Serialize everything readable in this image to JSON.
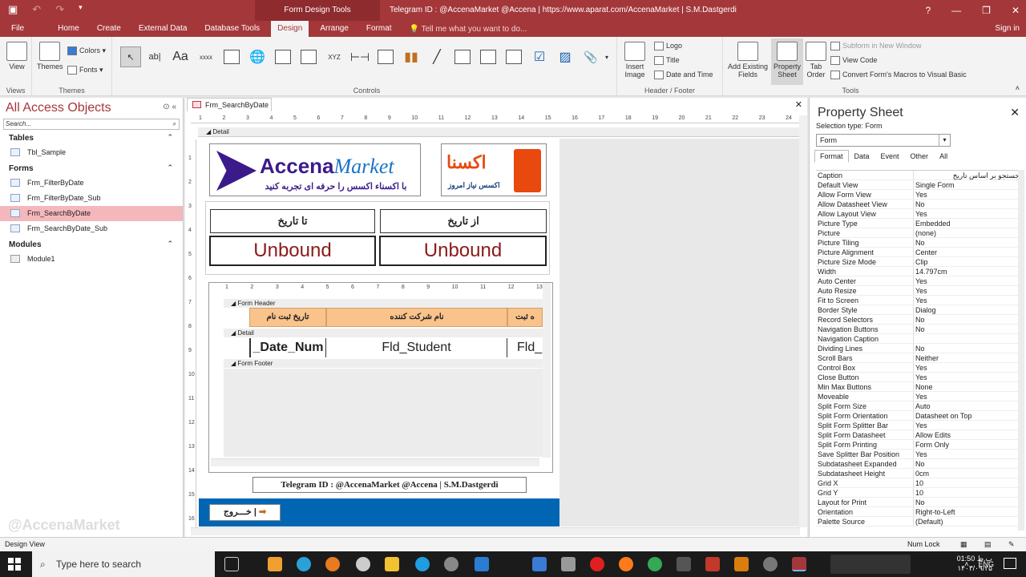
{
  "titlebar": {
    "context_tab": "Form Design Tools",
    "title": "Telegram ID : @AccenaMarket  @Accena  |  https://www.aparat.com/AccenaMarket  |  S.M.Dastgerdi",
    "help": "?"
  },
  "tabs": [
    {
      "label": "File"
    },
    {
      "label": "Home"
    },
    {
      "label": "Create"
    },
    {
      "label": "External Data"
    },
    {
      "label": "Database Tools"
    },
    {
      "label": "Design",
      "active": true
    },
    {
      "label": "Arrange"
    },
    {
      "label": "Format"
    }
  ],
  "tell_me": "Tell me what you want to do...",
  "sign_in": "Sign in",
  "ribbon": {
    "views": {
      "label": "Views",
      "view": "View"
    },
    "themes": {
      "label": "Themes",
      "themes": "Themes",
      "colors": "Colors",
      "fonts": "Fonts"
    },
    "controls": {
      "label": "Controls",
      "textbox": "ab|",
      "labelctl": "Aa",
      "button": "xxxx",
      "toggle": "XYZ"
    },
    "header_footer": {
      "label": "Header / Footer",
      "insert_image": "Insert Image",
      "logo": "Logo",
      "title": "Title",
      "date_time": "Date and Time"
    },
    "tools": {
      "label": "Tools",
      "add_fields": "Add Existing Fields",
      "property_sheet": "Property Sheet",
      "tab_order": "Tab Order",
      "subform": "Subform in New Window",
      "view_code": "View Code",
      "convert": "Convert Form's Macros to Visual Basic"
    }
  },
  "nav": {
    "title": "All Access Objects",
    "search_placeholder": "Search...",
    "sections": [
      {
        "name": "Tables",
        "items": [
          "Tbl_Sample"
        ]
      },
      {
        "name": "Forms",
        "items": [
          "Frm_FilterByDate",
          "Frm_FilterByDate_Sub",
          "Frm_SearchByDate",
          "Frm_SearchByDate_Sub"
        ],
        "selected": "Frm_SearchByDate"
      },
      {
        "name": "Modules",
        "items": [
          "Module1"
        ]
      }
    ]
  },
  "doc": {
    "tab": "Frm_SearchByDate",
    "detail": "Detail",
    "ruler_top": [
      "1",
      "2",
      "3",
      "4",
      "5",
      "6",
      "7",
      "8",
      "9",
      "10",
      "11",
      "12",
      "13",
      "14",
      "15",
      "16",
      "17",
      "18",
      "19",
      "20",
      "21",
      "22",
      "23",
      "24"
    ],
    "ruler_left": [
      "1",
      "2",
      "3",
      "4",
      "5",
      "6",
      "7",
      "8",
      "9",
      "10",
      "11",
      "12",
      "13",
      "14",
      "15",
      "16"
    ],
    "logo1": {
      "brand_a": "Accena",
      "brand_b": "Market",
      "slogan": "با اکسناء اکسس را حرفه ای تجربه کنید"
    },
    "logo2": {
      "brand": "اکسنا",
      "slogan": "اکسس نیاز امروز"
    },
    "to_date": "تا تاریخ",
    "from_date": "از تاریخ",
    "unbound_to": "Unbound",
    "unbound_from": "Unbound",
    "sub": {
      "ruler": [
        "1",
        "2",
        "3",
        "4",
        "5",
        "6",
        "7",
        "8",
        "9",
        "10",
        "11",
        "12",
        "13"
      ],
      "form_header": "Form Header",
      "detail": "Detail",
      "form_footer": "Form Footer",
      "headers": [
        "تاریخ ثبت نام",
        "نام شرکت کننده",
        "ه ثبت"
      ],
      "fields": [
        "_Date_Num",
        "Fld_Student",
        "Fld_"
      ]
    },
    "footer_label": "Telegram ID : @AccenaMarket   @Accena  |  S.M.Dastgerdi",
    "exit_button": "خـــروج  |",
    "watermark": "@AccenaMarket"
  },
  "props": {
    "title": "Property Sheet",
    "selection_type": "Selection type:  Form",
    "selected": "Form",
    "tabs": [
      "Format",
      "Data",
      "Event",
      "Other",
      "All"
    ],
    "rows": [
      [
        "Caption",
        "جستجو بر اساس تاریخ"
      ],
      [
        "Default View",
        "Single Form"
      ],
      [
        "Allow Form View",
        "Yes"
      ],
      [
        "Allow Datasheet View",
        "No"
      ],
      [
        "Allow Layout View",
        "Yes"
      ],
      [
        "Picture Type",
        "Embedded"
      ],
      [
        "Picture",
        "(none)"
      ],
      [
        "Picture Tiling",
        "No"
      ],
      [
        "Picture Alignment",
        "Center"
      ],
      [
        "Picture Size Mode",
        "Clip"
      ],
      [
        "Width",
        "14.797cm"
      ],
      [
        "Auto Center",
        "Yes"
      ],
      [
        "Auto Resize",
        "Yes"
      ],
      [
        "Fit to Screen",
        "Yes"
      ],
      [
        "Border Style",
        "Dialog"
      ],
      [
        "Record Selectors",
        "No"
      ],
      [
        "Navigation Buttons",
        "No"
      ],
      [
        "Navigation Caption",
        ""
      ],
      [
        "Dividing Lines",
        "No"
      ],
      [
        "Scroll Bars",
        "Neither"
      ],
      [
        "Control Box",
        "Yes"
      ],
      [
        "Close Button",
        "Yes"
      ],
      [
        "Min Max Buttons",
        "None"
      ],
      [
        "Moveable",
        "Yes"
      ],
      [
        "Split Form Size",
        "Auto"
      ],
      [
        "Split Form Orientation",
        "Datasheet on Top"
      ],
      [
        "Split Form Splitter Bar",
        "Yes"
      ],
      [
        "Split Form Datasheet",
        "Allow Edits"
      ],
      [
        "Split Form Printing",
        "Form Only"
      ],
      [
        "Save Splitter Bar Position",
        "Yes"
      ],
      [
        "Subdatasheet Expanded",
        "No"
      ],
      [
        "Subdatasheet Height",
        "0cm"
      ],
      [
        "Grid X",
        "10"
      ],
      [
        "Grid Y",
        "10"
      ],
      [
        "Layout for Print",
        "No"
      ],
      [
        "Orientation",
        "Right-to-Left"
      ],
      [
        "Palette Source",
        "(Default)"
      ]
    ]
  },
  "status": {
    "left": "Design View",
    "numlock": "Num Lock"
  },
  "taskbar": {
    "search": "Type here to search",
    "lang": "ENG",
    "time": "01:50 ب.ظ",
    "date": "۱۴۰۳/۰۹/۲۵"
  },
  "colors": {
    "accent": "#a4373a",
    "selected": "#f4b8bc",
    "header_cell": "#f9c38b",
    "exit_bar": "#0066b3"
  }
}
